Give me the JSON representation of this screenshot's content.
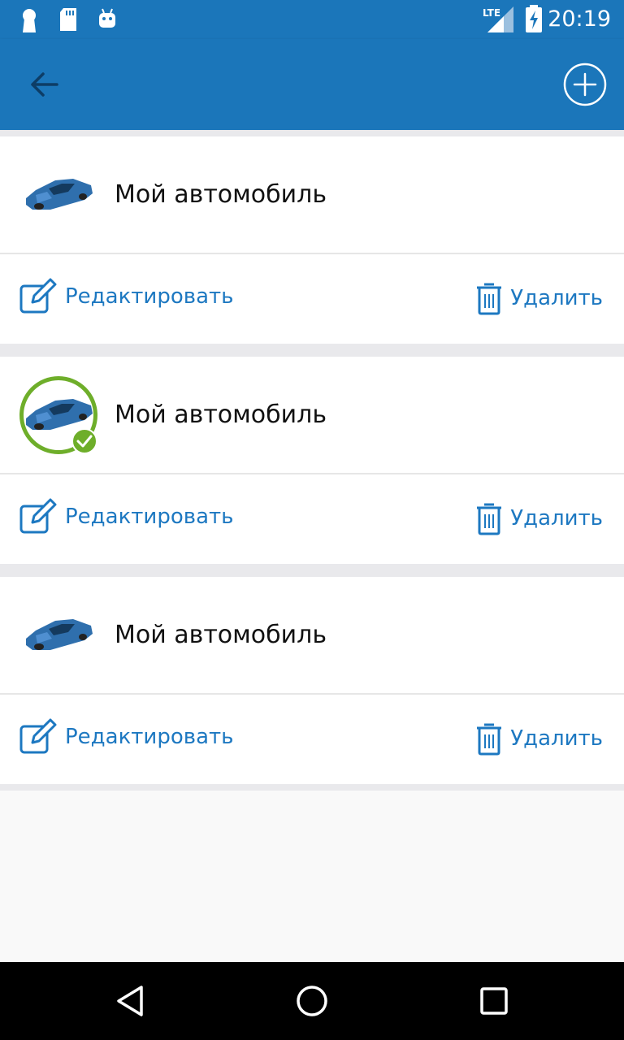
{
  "status_bar": {
    "time": "20:19",
    "network": "LTE",
    "left_icons": [
      "keyhole-icon",
      "sd-card-icon",
      "android-icon"
    ],
    "right_icons": [
      "lte-signal-icon",
      "battery-charging-icon"
    ]
  },
  "app_bar": {
    "color": "#1b76ba",
    "back_icon": "arrow-left-icon",
    "add_icon": "plus-circle-icon"
  },
  "cars": [
    {
      "name": "Мой автомобиль",
      "selected": false,
      "edit_label": "Редактировать",
      "delete_label": "Удалить"
    },
    {
      "name": "Мой автомобиль",
      "selected": true,
      "edit_label": "Редактировать",
      "delete_label": "Удалить"
    },
    {
      "name": "Мой автомобиль",
      "selected": false,
      "edit_label": "Редактировать",
      "delete_label": "Удалить"
    }
  ],
  "colors": {
    "accent": "#1d78c1",
    "selected_ring": "#6eae2a"
  },
  "nav_bar": {
    "buttons": [
      "back-triangle-icon",
      "home-circle-icon",
      "recents-square-icon"
    ]
  }
}
